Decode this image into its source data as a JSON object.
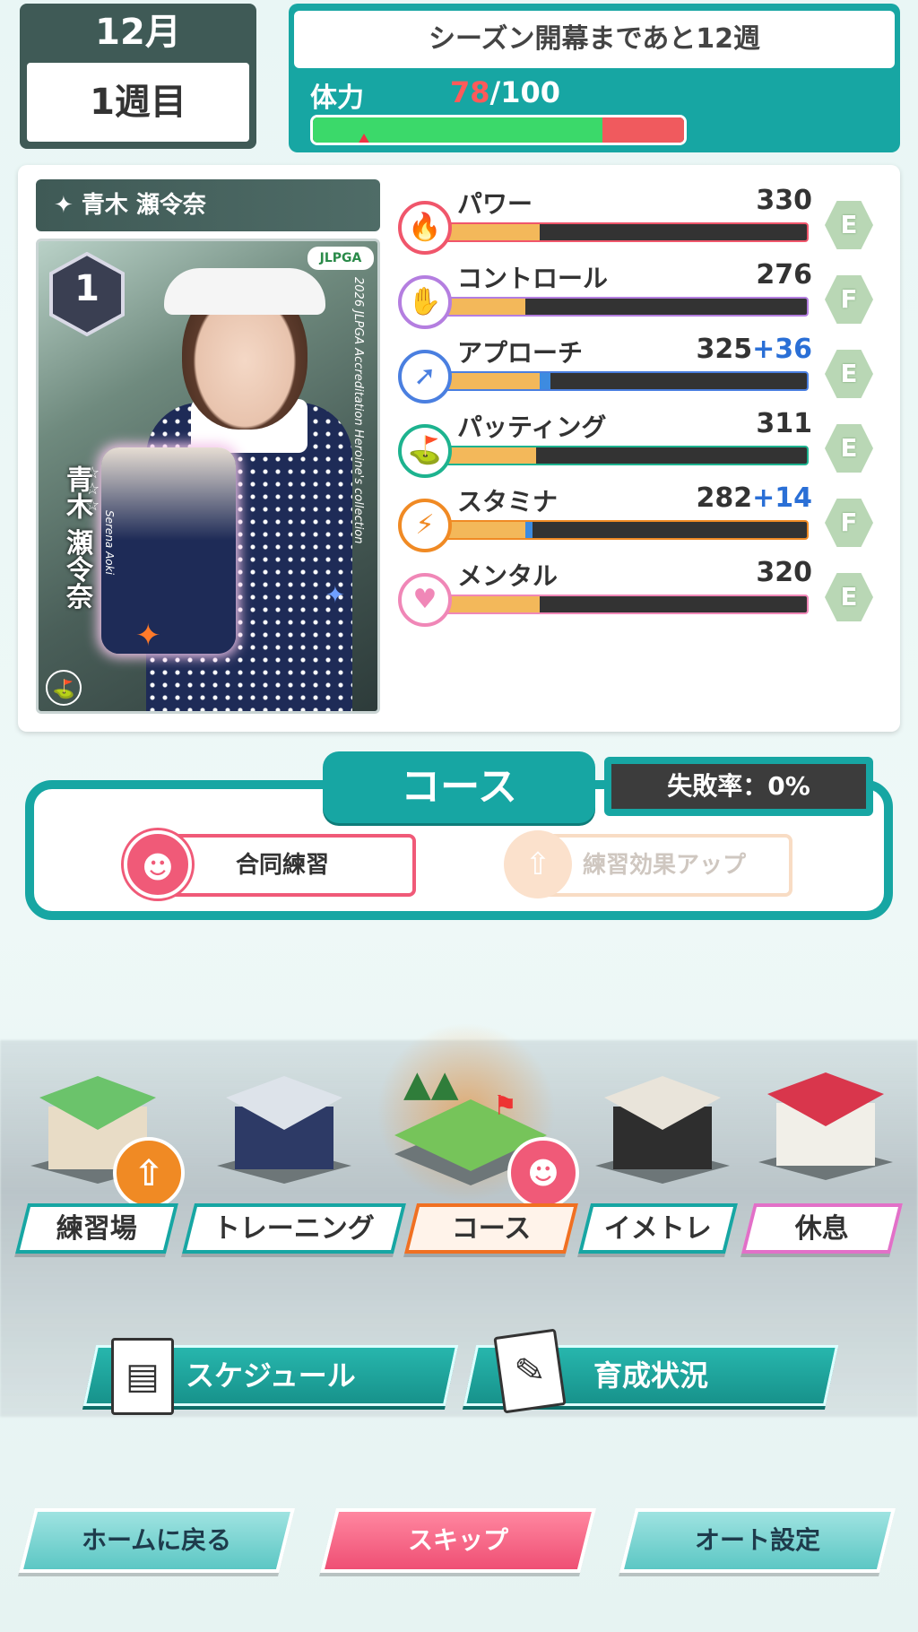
{
  "header": {
    "month": "12月",
    "week": "1週目",
    "season_text": "シーズン開幕まであと12週",
    "stamina_label": "体力",
    "stamina_current": "78",
    "stamina_max": "/100",
    "stamina_fraction": 0.78
  },
  "player": {
    "name": "青木 瀬令奈",
    "card": {
      "rank": "1",
      "org_badge": "JLPGA",
      "side_text": "2026 JLPGA Accreditation Heroine's collection",
      "vertical_name": "青木 瀬令奈",
      "romaji": "Serena Aoki"
    }
  },
  "stats": [
    {
      "label": "パワー",
      "value": "330",
      "bonus": "",
      "grade": "E",
      "icon": "fire-icon",
      "color": "#f0566b",
      "fill": 0.27,
      "bonus_fill": 0
    },
    {
      "label": "コントロール",
      "value": "276",
      "bonus": "",
      "grade": "F",
      "icon": "hand-icon",
      "color": "#b47ee0",
      "fill": 0.23,
      "bonus_fill": 0
    },
    {
      "label": "アプローチ",
      "value": "325",
      "bonus": "+36",
      "grade": "E",
      "icon": "approach-icon",
      "color": "#4a7fe0",
      "fill": 0.27,
      "bonus_fill": 0.03
    },
    {
      "label": "パッティング",
      "value": "311",
      "bonus": "",
      "grade": "E",
      "icon": "putting-icon",
      "color": "#1db38f",
      "fill": 0.26,
      "bonus_fill": 0
    },
    {
      "label": "スタミナ",
      "value": "282",
      "bonus": "+14",
      "grade": "F",
      "icon": "lightning-icon",
      "color": "#f08a24",
      "fill": 0.23,
      "bonus_fill": 0.02
    },
    {
      "label": "メンタル",
      "value": "320",
      "bonus": "",
      "grade": "E",
      "icon": "heart-icon",
      "color": "#f087b7",
      "fill": 0.27,
      "bonus_fill": 0
    }
  ],
  "course": {
    "title": "コース",
    "fail_rate": "失敗率：0%",
    "options": [
      {
        "label": "合同練習",
        "active": true
      },
      {
        "label": "練習効果アップ",
        "active": false
      }
    ]
  },
  "facilities": [
    {
      "label": "練習場",
      "selected": false
    },
    {
      "label": "トレーニング",
      "selected": false
    },
    {
      "label": "コース",
      "selected": true
    },
    {
      "label": "イメトレ",
      "selected": false
    },
    {
      "label": "休息",
      "selected": false
    }
  ],
  "actions": {
    "schedule": "スケジュール",
    "progress": "育成状況"
  },
  "footer": {
    "home": "ホームに戻る",
    "skip": "スキップ",
    "auto": "オート設定"
  },
  "colors": {
    "teal": "#17a6a3",
    "dark_panel": "#3f5a56",
    "pink": "#f05a78",
    "orange": "#f08a24"
  }
}
